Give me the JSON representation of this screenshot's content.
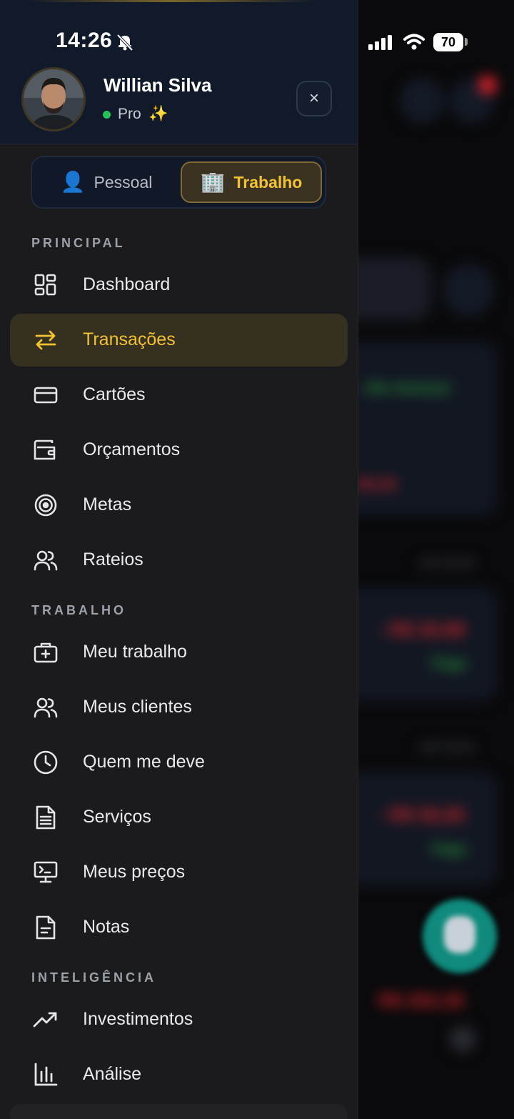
{
  "status_bar": {
    "time": "14:26",
    "battery": "70"
  },
  "user": {
    "name": "Willian Silva",
    "plan": "Pro",
    "plan_emoji": "✨"
  },
  "close_label": "×",
  "mode_toggle": {
    "personal": {
      "emoji": "👤",
      "label": "Pessoal"
    },
    "work": {
      "emoji": "🏢",
      "label": "Trabalho"
    },
    "selected": "work"
  },
  "sections": {
    "principal": "PRINCIPAL",
    "trabalho": "TRABALHO",
    "inteligencia": "INTELIGÊNCIA"
  },
  "menu": {
    "principal": [
      {
        "label": "Dashboard",
        "icon": "dashboard-icon"
      },
      {
        "label": "Transações",
        "icon": "transfer-arrows-icon",
        "active": true
      },
      {
        "label": "Cartões",
        "icon": "credit-card-icon"
      },
      {
        "label": "Orçamentos",
        "icon": "wallet-icon"
      },
      {
        "label": "Metas",
        "icon": "target-icon"
      },
      {
        "label": "Rateios",
        "icon": "users-icon"
      }
    ],
    "trabalho": [
      {
        "label": "Meu trabalho",
        "icon": "briefcase-icon"
      },
      {
        "label": "Meus clientes",
        "icon": "users-icon"
      },
      {
        "label": "Quem me deve",
        "icon": "clock-icon"
      },
      {
        "label": "Serviços",
        "icon": "document-icon"
      },
      {
        "label": "Meus preços",
        "icon": "monitor-icon"
      },
      {
        "label": "Notas",
        "icon": "note-icon"
      }
    ],
    "inteligencia": [
      {
        "label": "Investimentos",
        "icon": "trending-up-icon"
      },
      {
        "label": "Análise",
        "icon": "bar-chart-icon"
      }
    ]
  },
  "colors": {
    "accent": "#f2c230",
    "drawer_bg": "#1b1b1d",
    "header_bg": "#111a2b",
    "active_bg": "#35301f",
    "online": "#24c45a"
  }
}
